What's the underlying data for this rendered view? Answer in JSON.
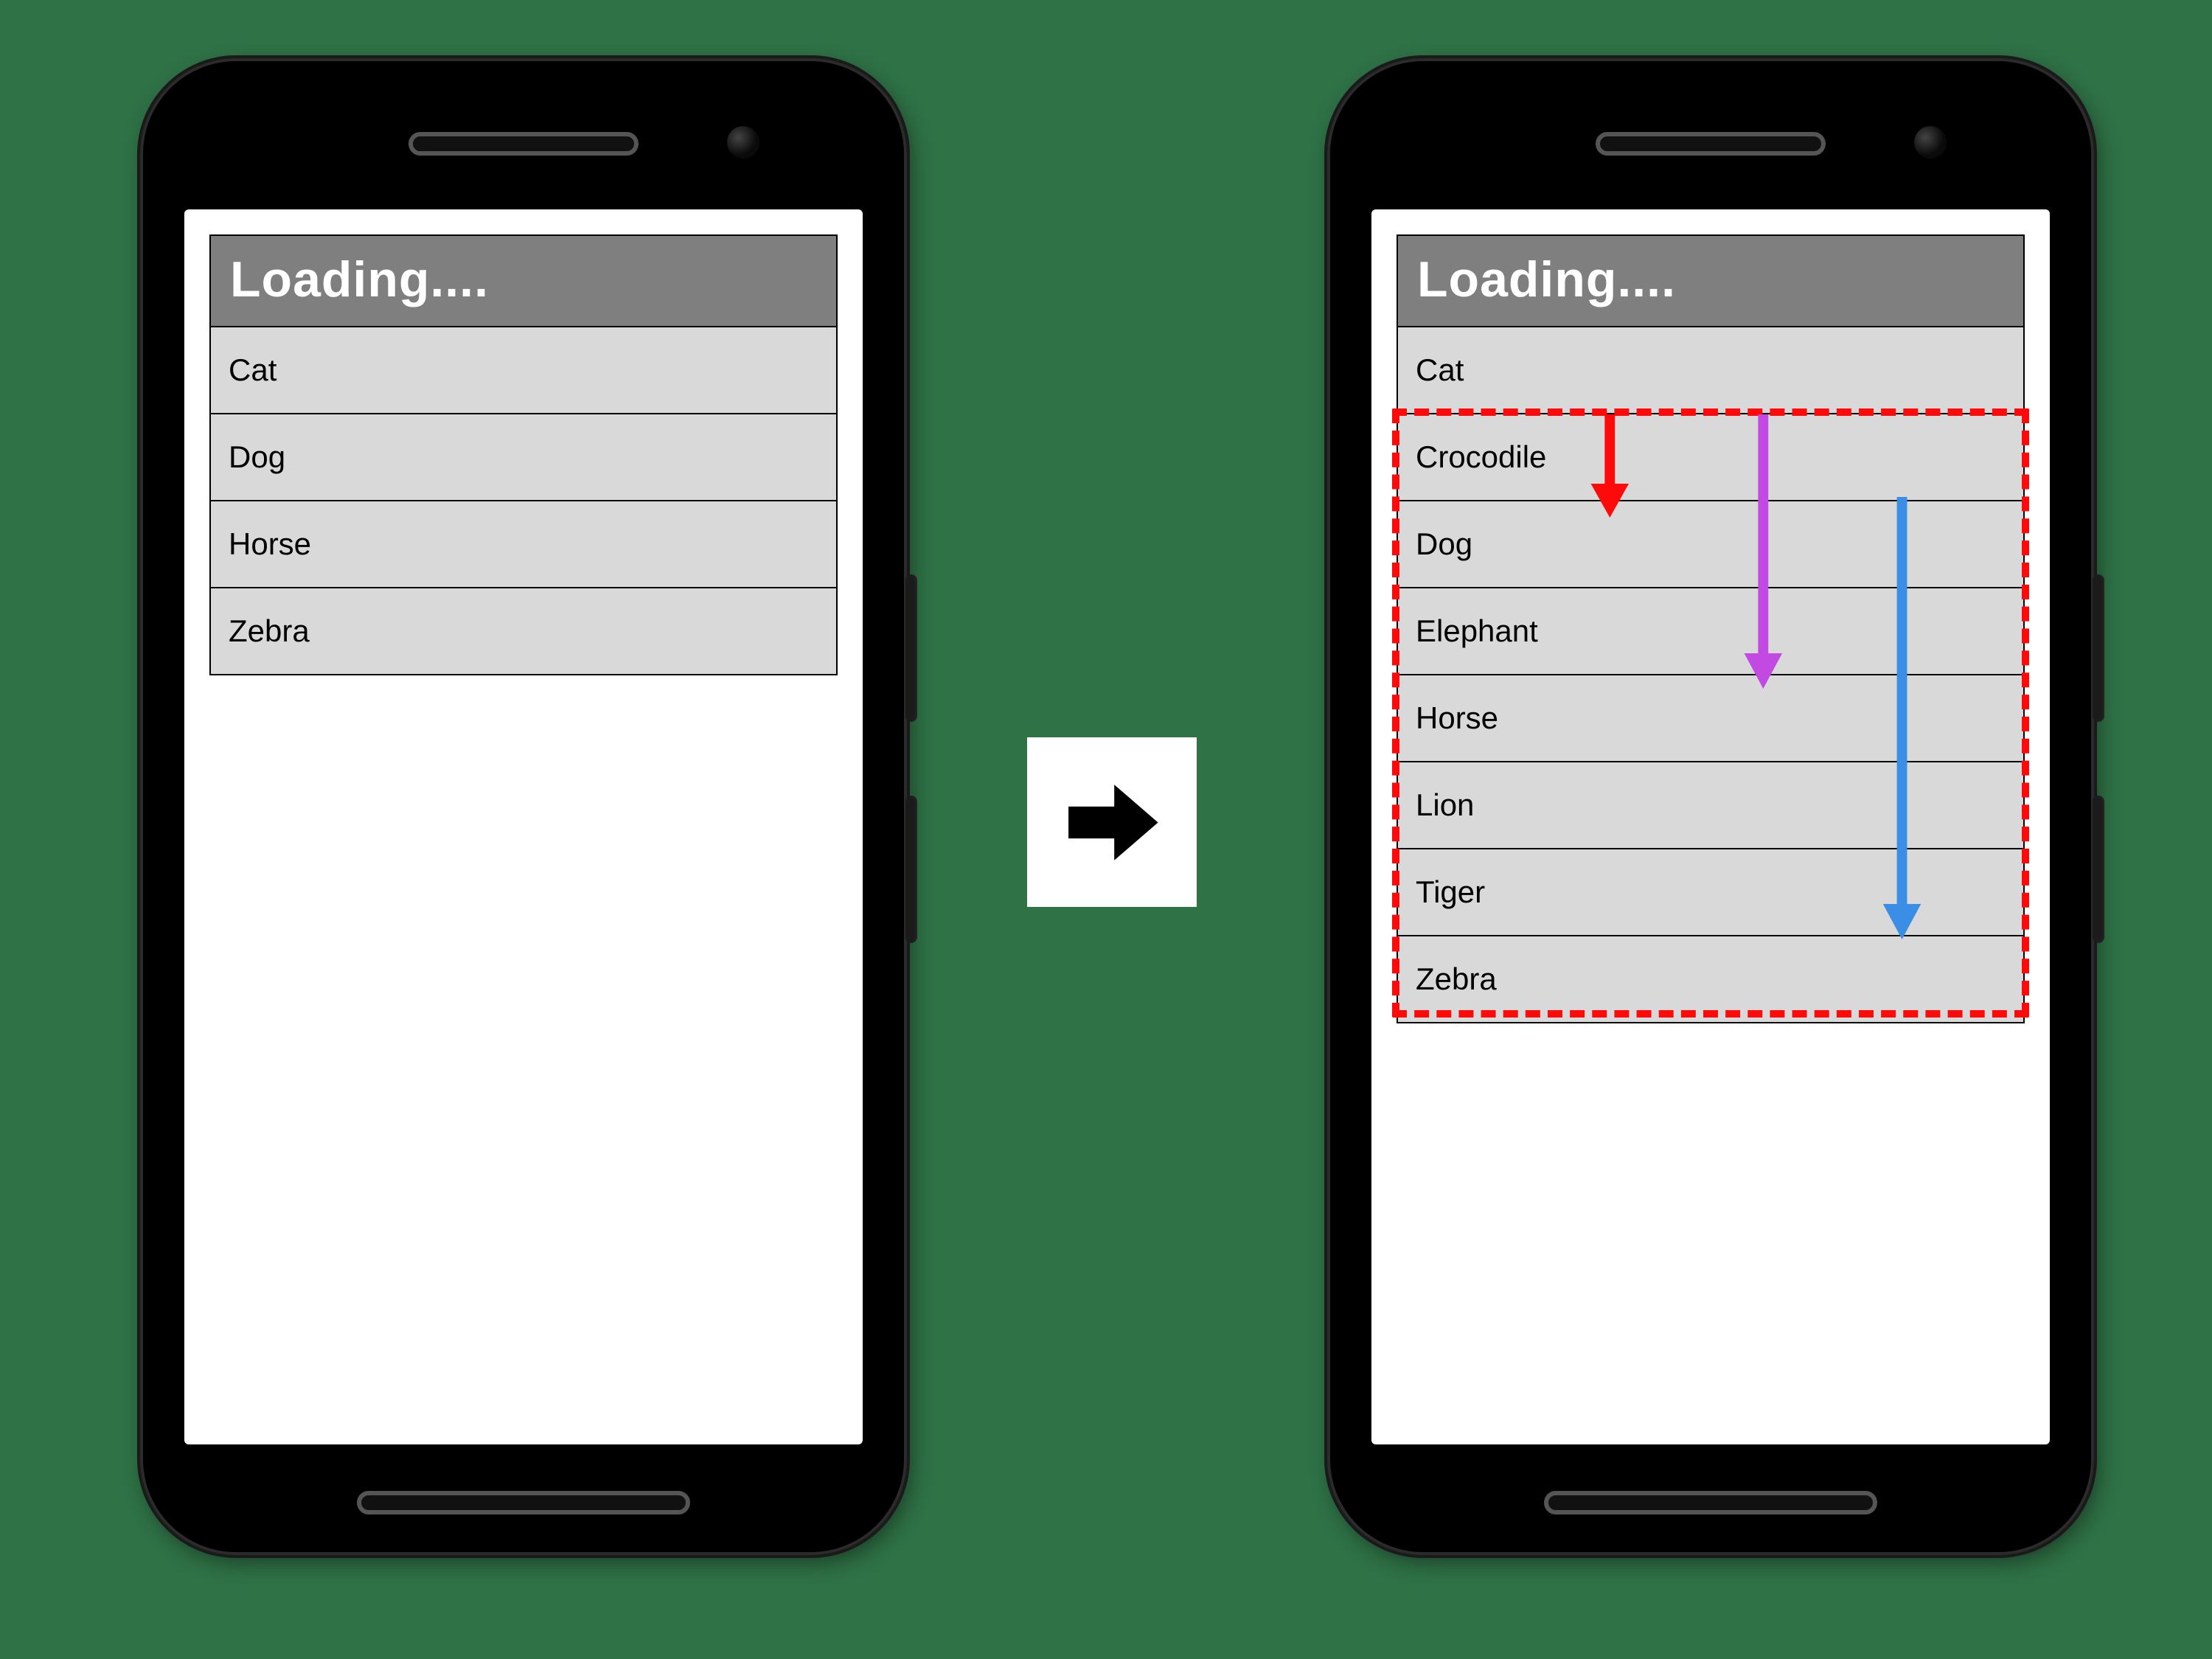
{
  "app_title": "Loading....",
  "left_phone": {
    "items": [
      "Cat",
      "Dog",
      "Horse",
      "Zebra"
    ]
  },
  "right_phone": {
    "items": [
      "Cat",
      "Crocodile",
      "Dog",
      "Elephant",
      "Horse",
      "Lion",
      "Tiger",
      "Zebra"
    ],
    "highlight_start_index": 1,
    "highlight_end_index": 7
  },
  "arrows": {
    "red": {
      "color": "#ff0a0a"
    },
    "purple": {
      "color": "#c24ae3"
    },
    "blue": {
      "color": "#3a8ee6"
    }
  },
  "transition_glyph": "arrow-right"
}
